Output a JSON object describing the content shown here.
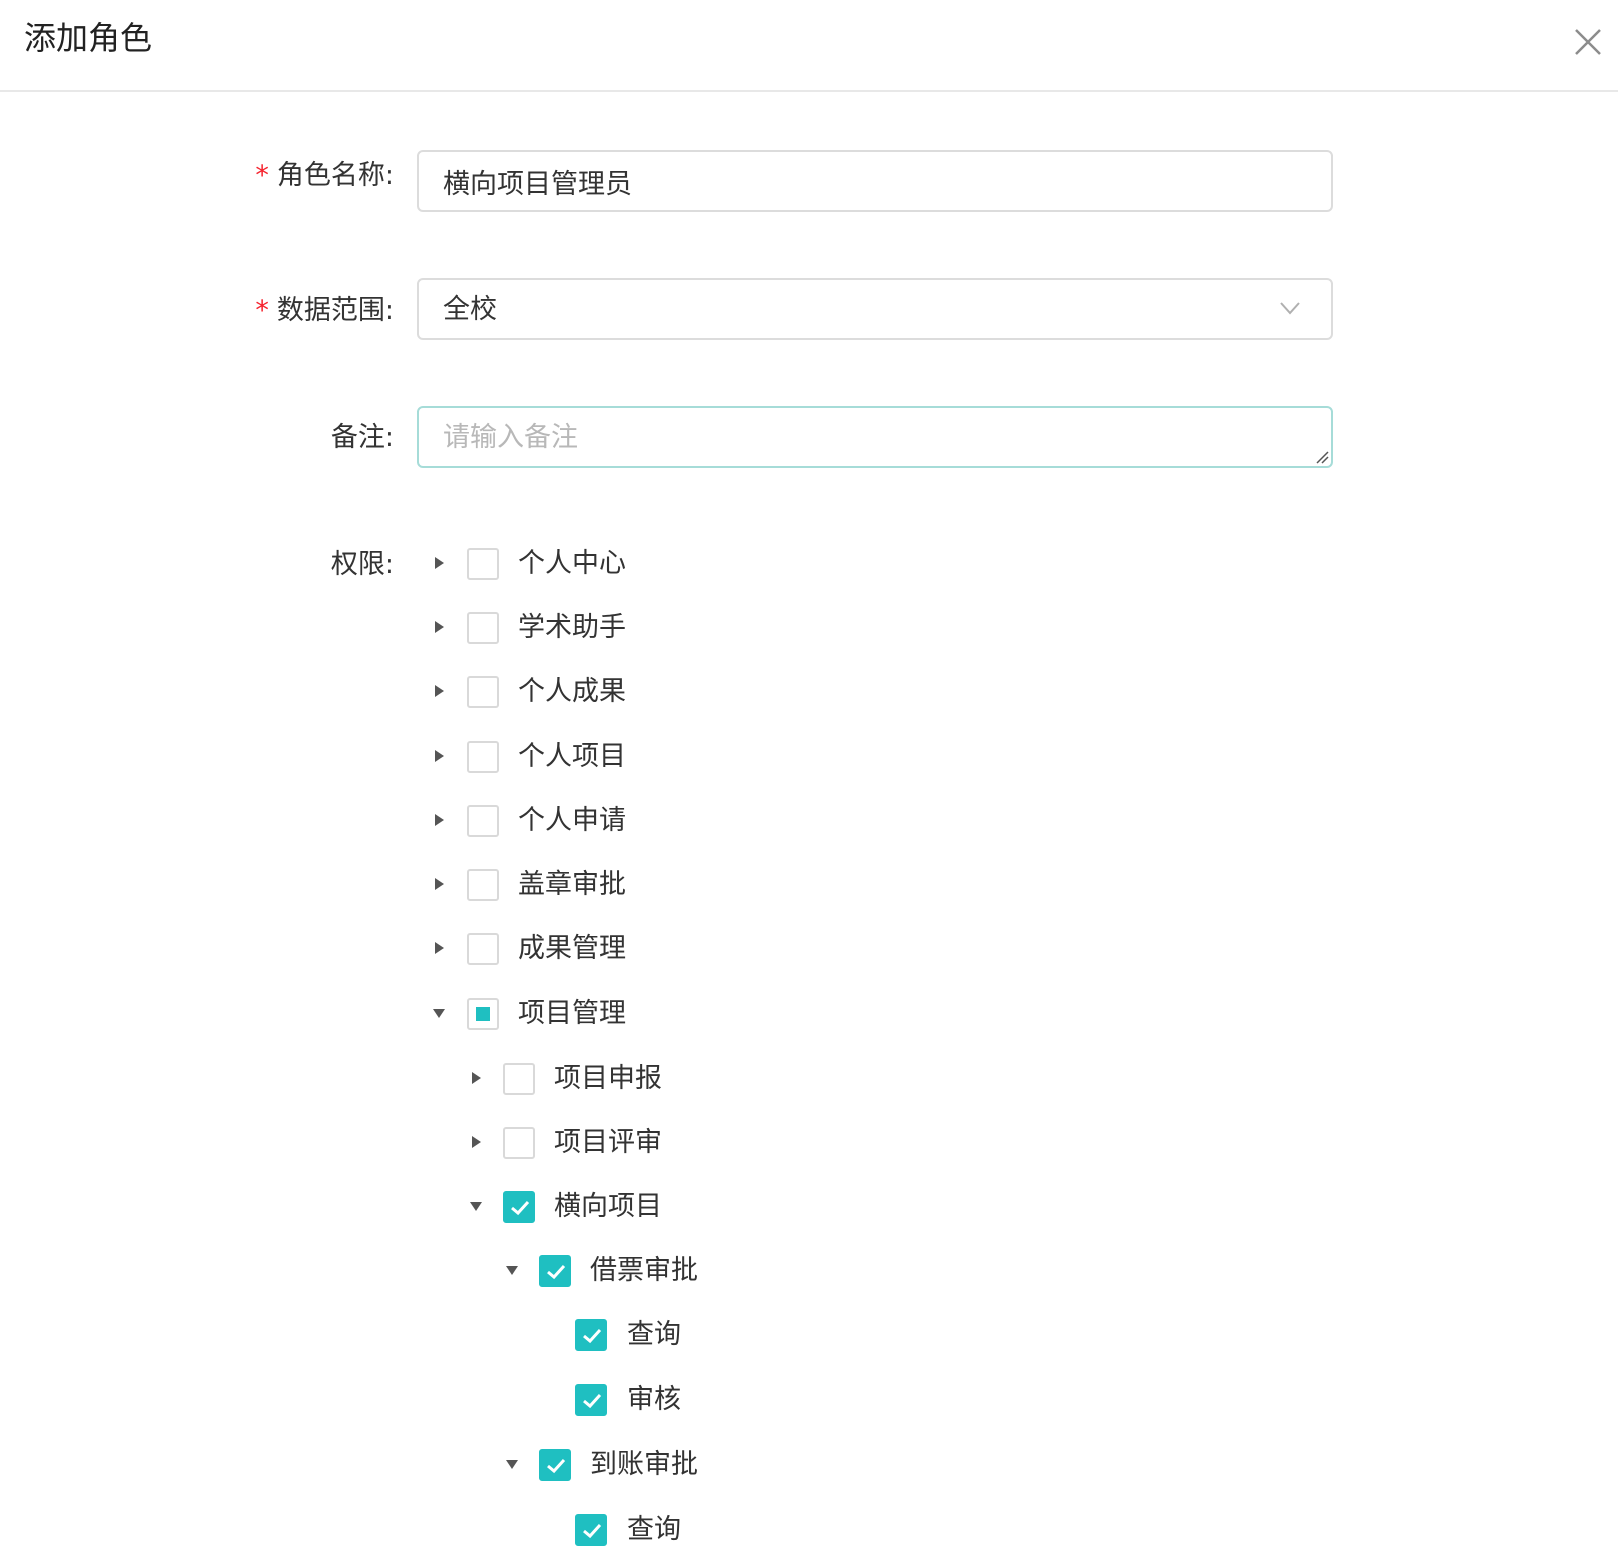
{
  "dialog": {
    "title": "添加角色"
  },
  "form": {
    "role_name": {
      "label": "角色名称:",
      "required_mark": "*",
      "value": "横向项目管理员"
    },
    "data_scope": {
      "label": "数据范围:",
      "required_mark": "*",
      "selected": "全校"
    },
    "remark": {
      "label": "备注:",
      "placeholder": "请输入备注"
    },
    "permissions": {
      "label": "权限:"
    }
  },
  "tree": [
    {
      "label": "个人中心",
      "state": "unchecked",
      "expanded": false
    },
    {
      "label": "学术助手",
      "state": "unchecked",
      "expanded": false
    },
    {
      "label": "个人成果",
      "state": "unchecked",
      "expanded": false
    },
    {
      "label": "个人项目",
      "state": "unchecked",
      "expanded": false
    },
    {
      "label": "个人申请",
      "state": "unchecked",
      "expanded": false
    },
    {
      "label": "盖章审批",
      "state": "unchecked",
      "expanded": false
    },
    {
      "label": "成果管理",
      "state": "unchecked",
      "expanded": false
    },
    {
      "label": "项目管理",
      "state": "indeterminate",
      "expanded": true
    },
    {
      "label": "项目申报",
      "state": "unchecked",
      "expanded": false
    },
    {
      "label": "项目评审",
      "state": "unchecked",
      "expanded": false
    },
    {
      "label": "横向项目",
      "state": "checked",
      "expanded": true
    },
    {
      "label": "借票审批",
      "state": "checked",
      "expanded": true
    },
    {
      "label": "查询",
      "state": "checked",
      "leaf": true
    },
    {
      "label": "审核",
      "state": "checked",
      "leaf": true
    },
    {
      "label": "到账审批",
      "state": "checked",
      "expanded": true
    },
    {
      "label": "查询",
      "state": "checked",
      "leaf": true
    }
  ],
  "colors": {
    "accent": "#1fbfc1",
    "required": "#f5222d",
    "border": "#dcdcdc"
  }
}
